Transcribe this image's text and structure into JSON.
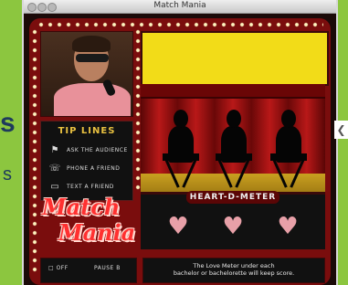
{
  "window": {
    "title": "Match Mania"
  },
  "background_text": {
    "letter": "s",
    "small_letter": "s"
  },
  "tips": {
    "header": "TIP LINES",
    "items": [
      {
        "label": "ASK THE AUDIENCE",
        "icon": "audience-icon"
      },
      {
        "label": "PHONE A FRIEND",
        "icon": "phone-icon"
      },
      {
        "label": "TEXT A FRIEND",
        "icon": "text-message-icon"
      }
    ]
  },
  "logo": {
    "line1": "Match",
    "line2": "Mania"
  },
  "meter": {
    "title": "HEART-D-METER"
  },
  "controls": {
    "off_label": "OFF",
    "pause_label": "PAUSE B"
  },
  "info": {
    "line1": "The Love Meter under each",
    "line2": "bachelor or bachelorette will keep score."
  },
  "colors": {
    "accent": "#f2dc18",
    "brand_red": "#7a0d0d",
    "heart": "#e8a0a8",
    "page_bg": "#8cc63f"
  }
}
